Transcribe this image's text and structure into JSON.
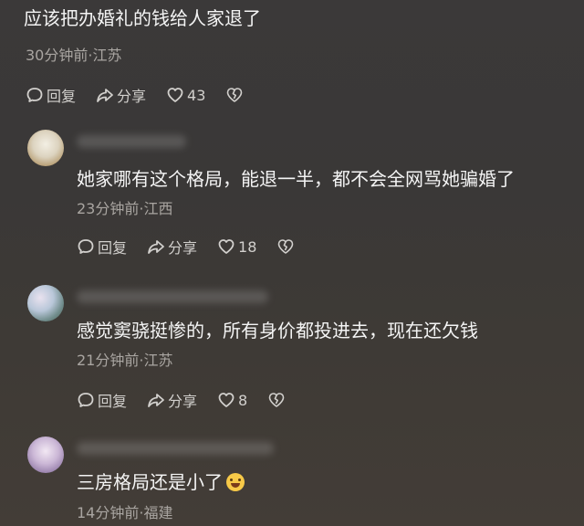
{
  "comments": [
    {
      "text": "应该把办婚礼的钱给人家退了",
      "meta": "30分钟前·江苏",
      "reply_label": "回复",
      "share_label": "分享",
      "likes": "43"
    },
    {
      "text": "她家哪有这个格局，能退一半，都不会全网骂她骗婚了",
      "meta": "23分钟前·江西",
      "reply_label": "回复",
      "share_label": "分享",
      "likes": "18"
    },
    {
      "text": "感觉窦骁挺惨的，所有身价都投进去，现在还欠钱",
      "meta": "21分钟前·江苏",
      "reply_label": "回复",
      "share_label": "分享",
      "likes": "8"
    },
    {
      "text": "三房格局还是小了",
      "meta": "14分钟前·福建"
    }
  ],
  "icons": {
    "reply": "reply-bubble-icon",
    "share": "share-arrow-icon",
    "like": "heart-icon",
    "dislike": "broken-heart-icon",
    "emoji": "laughing-tears-emoji"
  },
  "colors": {
    "background": "#3b3939",
    "text": "#f4f4f4",
    "meta": "#a9a5a1",
    "actions": "#d2d0cd"
  }
}
